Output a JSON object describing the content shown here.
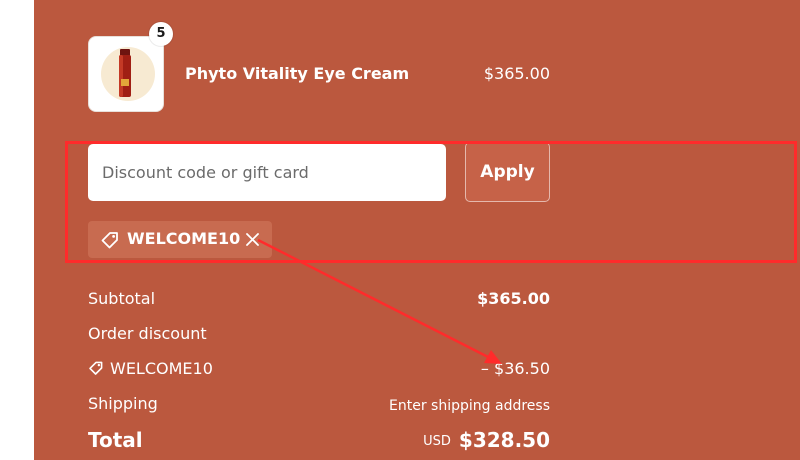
{
  "colors": {
    "panel_bg": "#bb583e",
    "annotation_red": "#ff2b2b",
    "text": "#ffffff"
  },
  "product": {
    "name": "Phyto Vitality Eye Cream",
    "price": "$365.00",
    "quantity": "5",
    "thumbnail_icon": "cream-bottle-image"
  },
  "discount": {
    "placeholder": "Discount code or gift card",
    "value": "",
    "apply_label": "Apply",
    "applied_code": "WELCOME10"
  },
  "summary": {
    "subtotal_label": "Subtotal",
    "subtotal_value": "$365.00",
    "order_discount_label": "Order discount",
    "discount_code": "WELCOME10",
    "discount_value": "– $36.50",
    "shipping_label": "Shipping",
    "shipping_value": "Enter shipping address",
    "total_label": "Total",
    "total_currency": "USD",
    "total_value": "$328.50"
  }
}
